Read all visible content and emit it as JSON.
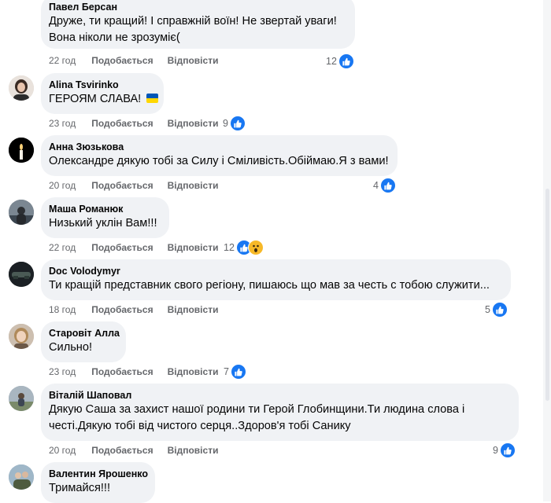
{
  "colors": {
    "accent": "#1877f2",
    "bubble": "#f0f2f5",
    "meta": "#65676b"
  },
  "comments": [
    {
      "author": "Павел Берсан",
      "lines": [
        "Друже, ти кращий! І справжній воїн! Не звертай уваги!",
        "Вона ніколи не зрозуміє("
      ],
      "age": "22 год",
      "like": "Подобається",
      "reply": "Відповісти",
      "reactions": "12",
      "reaction_icons": [
        "like-icon"
      ]
    },
    {
      "author": "Alina Tsvirinko",
      "lines": [
        "ГЕРОЯМ СЛАВА!"
      ],
      "flag": "ukraine-flag-icon",
      "age": "23 год",
      "like": "Подобається",
      "reply": "Відповісти",
      "reactions": "9",
      "reaction_icons": [
        "like-icon"
      ]
    },
    {
      "author": "Анна Зюзькова",
      "lines": [
        "Олександре дякую тобі за Силу і Сміливість.Обіймаю.Я з вами!"
      ],
      "age": "20 год",
      "like": "Подобається",
      "reply": "Відповісти",
      "reactions": "4",
      "reaction_icons": [
        "like-icon"
      ]
    },
    {
      "author": "Маша Романюк",
      "lines": [
        "Низький уклін Вам!!!"
      ],
      "age": "22 год",
      "like": "Подобається",
      "reply": "Відповісти",
      "reactions": "12",
      "reaction_icons": [
        "like-icon",
        "wow-icon"
      ]
    },
    {
      "author": "Doc Volodymyr",
      "lines": [
        "Ти кращій представник свого регіону, пишаюсь що мав за честь с тобою служити..."
      ],
      "age": "18 год",
      "like": "Подобається",
      "reply": "Відповісти",
      "reactions": "5",
      "reaction_icons": [
        "like-icon"
      ]
    },
    {
      "author": "Старовіт Алла",
      "lines": [
        "Сильно!"
      ],
      "age": "23 год",
      "like": "Подобається",
      "reply": "Відповісти",
      "reactions": "7",
      "reaction_icons": [
        "like-icon"
      ]
    },
    {
      "author": "Віталій Шаповал",
      "lines": [
        "Дякую Саша за захист нашої родини ти Герой Глобинщини.Ти людина слова і",
        "честі.Дякую тобі від чистого серця..Здоров'я тобі Санику"
      ],
      "age": "20 год",
      "like": "Подобається",
      "reply": "Відповісти",
      "reactions": "9",
      "reaction_icons": [
        "like-icon"
      ]
    },
    {
      "author": "Валентин Ярошенко",
      "lines": [
        "Тримайся!!!"
      ]
    }
  ]
}
